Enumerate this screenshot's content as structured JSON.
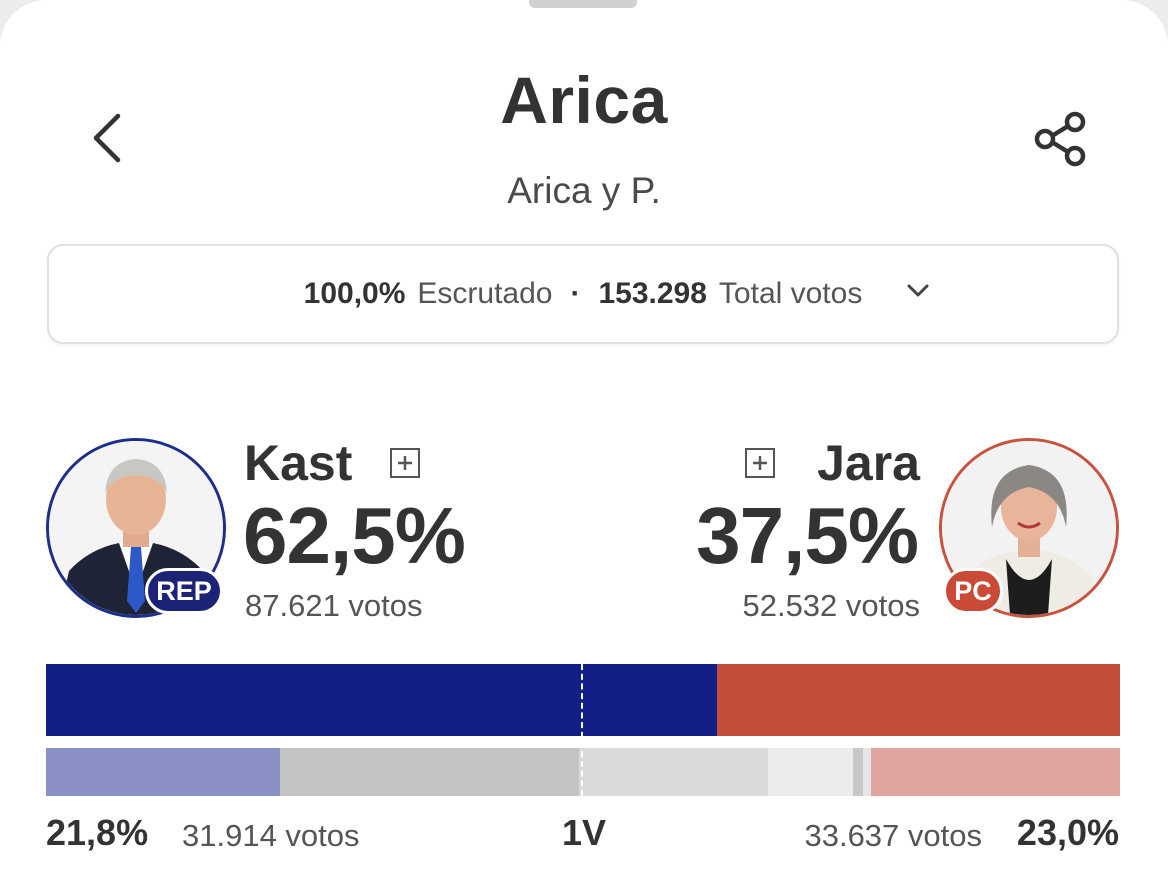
{
  "header": {
    "title": "Arica",
    "subtitle": "Arica y P.",
    "back_icon": "chevron-left-icon",
    "share_icon": "share-icon"
  },
  "summary": {
    "scrutinized_value": "100,0%",
    "scrutinized_label": "Escrutado",
    "separator": "·",
    "total_value": "153.298",
    "total_label": "Total votos",
    "expand_icon": "chevron-down-icon"
  },
  "candidates": {
    "kast": {
      "name": "Kast",
      "percent": "62,5%",
      "votes": "87.621 votos",
      "party": "REP",
      "color": "#131f87",
      "share": 0.625
    },
    "jara": {
      "name": "Jara",
      "percent": "37,5%",
      "votes": "52.532 votos",
      "party": "PC",
      "color": "#c44e3c",
      "share": 0.375
    }
  },
  "first_round": {
    "label": "1V",
    "left_percent": "21,8%",
    "left_votes": "31.914 votos",
    "right_votes": "33.637 votos",
    "right_percent": "23,0%",
    "segments": [
      {
        "share": 0.218,
        "color": "#8a8fc4"
      },
      {
        "share": 0.278,
        "color": "#c4c4c4"
      },
      {
        "share": 0.176,
        "color": "#dadada"
      },
      {
        "share": 0.079,
        "color": "#ececec"
      },
      {
        "share": 0.01,
        "color": "#c8c8c8"
      },
      {
        "share": 0.007,
        "color": "#e6e6e6"
      },
      {
        "share": 0.232,
        "color": "#dea69f"
      }
    ]
  },
  "colors": {
    "rep_badge": "#1c2377",
    "pc_badge": "#c94a36"
  }
}
